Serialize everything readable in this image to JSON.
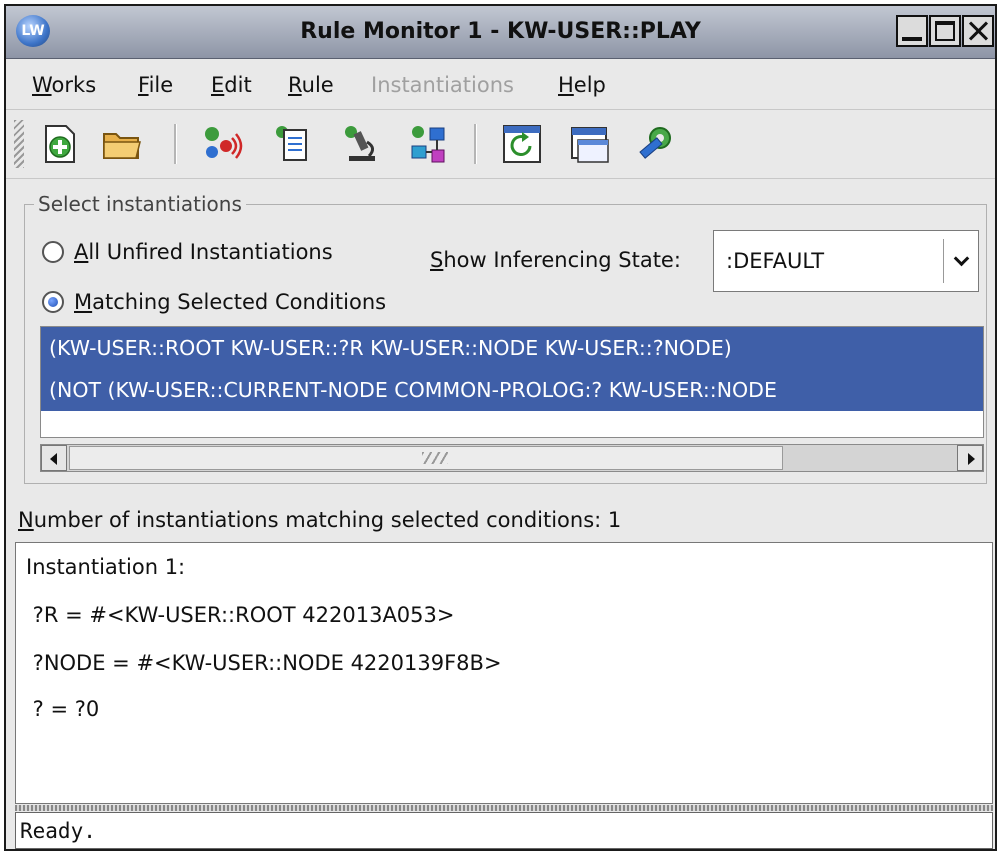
{
  "window": {
    "title": "Rule Monitor 1 - KW-USER::PLAY",
    "app_icon": "LW"
  },
  "menu": [
    {
      "mnemonic": "W",
      "rest": "orks",
      "enabled": true
    },
    {
      "mnemonic": "F",
      "rest": "ile",
      "enabled": true
    },
    {
      "mnemonic": "E",
      "rest": "dit",
      "enabled": true
    },
    {
      "mnemonic": "R",
      "rest": "ule",
      "enabled": true
    },
    {
      "mnemonic": "",
      "rest": "Instantiations",
      "enabled": false
    },
    {
      "mnemonic": "H",
      "rest": "elp",
      "enabled": true
    }
  ],
  "toolbar": {
    "icons": [
      "new-document-icon",
      "open-folder-icon",
      "rule-fire-icon",
      "rule-edit-icon",
      "inspect-microscope-icon",
      "network-nodes-icon",
      "refresh-icon",
      "window-icon",
      "settings-gear-icon"
    ]
  },
  "select_instantiations": {
    "group_label": "Select instantiations",
    "option_all": {
      "mnemonic": "A",
      "rest": "ll Unfired Instantiations",
      "selected": false
    },
    "option_matching": {
      "mnemonic": "M",
      "rest": "atching Selected Conditions",
      "selected": true
    },
    "state_label": {
      "mnemonic": "S",
      "rest": "how Inferencing State:"
    },
    "state_value": ":DEFAULT",
    "conditions": [
      "(KW-USER::ROOT KW-USER::?R KW-USER::NODE KW-USER::?NODE)",
      "(NOT (KW-USER::CURRENT-NODE COMMON-PROLOG:? KW-USER::NODE"
    ]
  },
  "count": {
    "mnemonic": "N",
    "rest": "umber of instantiations matching selected conditions: 1"
  },
  "details": [
    "Instantiation 1:",
    " ?R = #<KW-USER::ROOT 422013A053>",
    " ?NODE = #<KW-USER::NODE 4220139F8B>",
    " ? = ?0"
  ],
  "status": "Ready.",
  "colors": {
    "selection": "#3f5fa8",
    "titlebar": "#a7adbb",
    "window_bg": "#e9e9e9"
  }
}
